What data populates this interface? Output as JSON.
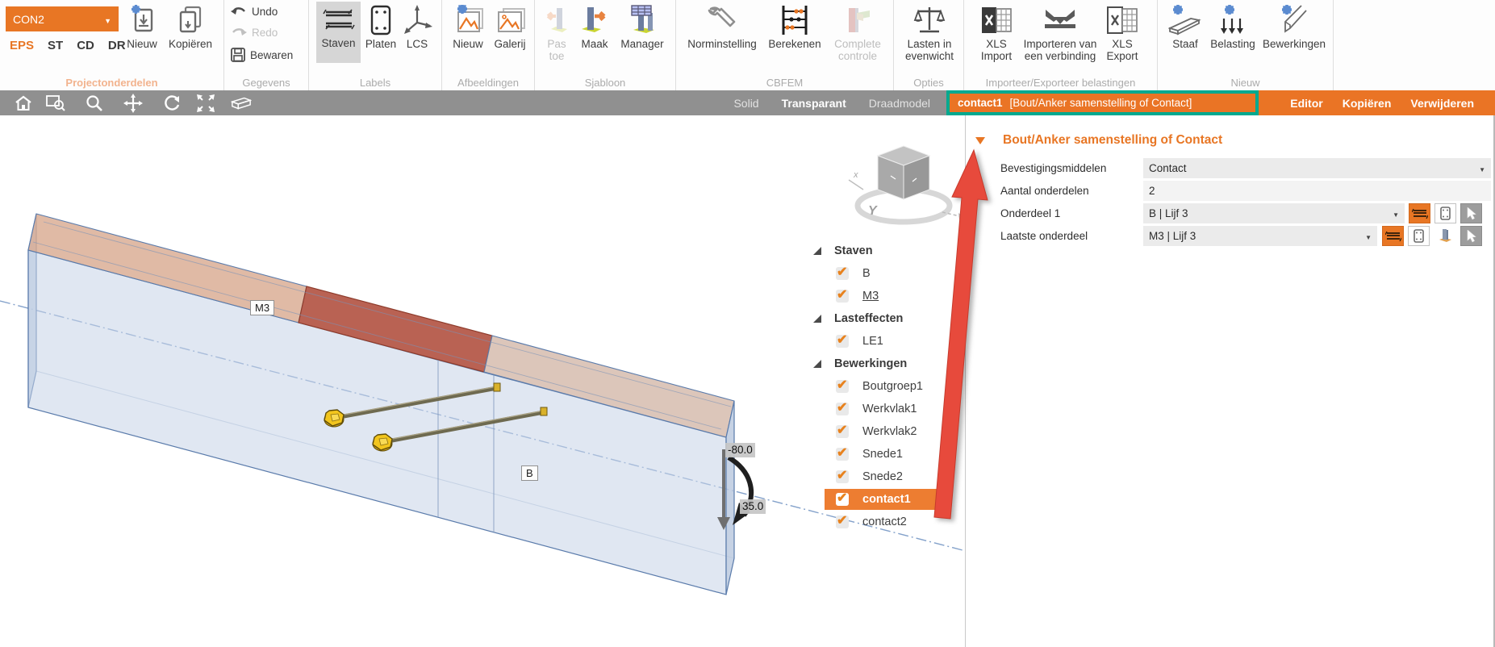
{
  "ribbon": {
    "project": {
      "selector": "CON2",
      "tabs": [
        "EPS",
        "ST",
        "CD",
        "DR"
      ],
      "active_tab": "EPS",
      "nieuw": "Nieuw",
      "kopieren": "Kopiëren",
      "group_label": "Projectonderdelen"
    },
    "gegevens": {
      "undo": "Undo",
      "redo": "Redo",
      "bewaren": "Bewaren",
      "group_label": "Gegevens"
    },
    "labels": {
      "staven": "Staven",
      "platen": "Platen",
      "lcs": "LCS",
      "group_label": "Labels",
      "active": "Staven"
    },
    "afbeeldingen": {
      "nieuw": "Nieuw",
      "galerij": "Galerij",
      "group_label": "Afbeeldingen"
    },
    "sjabloon": {
      "pas_toe": "Pas toe",
      "maak": "Maak",
      "manager": "Manager",
      "group_label": "Sjabloon"
    },
    "cbfem": {
      "norminstelling": "Norminstelling",
      "berekenen": "Berekenen",
      "complete_controle": "Complete controle",
      "group_label": "CBFEM"
    },
    "opties": {
      "lasten": "Lasten in evenwicht",
      "group_label": "Opties"
    },
    "import_export": {
      "xls_import": "XLS Import",
      "import_verbinding": "Importeren van een verbinding",
      "xls_export": "XLS Export",
      "group_label": "Importeer/Exporteer belastingen"
    },
    "nieuw_groep": {
      "staaf": "Staaf",
      "belasting": "Belasting",
      "bewerkingen": "Bewerkingen",
      "group_label": "Nieuw"
    }
  },
  "viewbar": {
    "modes": [
      "Solid",
      "Transparant",
      "Draadmodel"
    ],
    "active_mode": "Transparant"
  },
  "selection_header": {
    "name": "contact1",
    "type": "[Bout/Anker samenstelling of Contact]",
    "actions": [
      "Editor",
      "Kopiëren",
      "Verwijderen"
    ]
  },
  "properties": {
    "section_title": "Bout/Anker samenstelling of Contact",
    "rows": [
      {
        "label": "Bevestigingsmiddelen",
        "value": "Contact",
        "type": "dropdown"
      },
      {
        "label": "Aantal onderdelen",
        "value": "2",
        "type": "text"
      },
      {
        "label": "Onderdeel 1",
        "value": "B | Lijf 3",
        "type": "dropdown"
      },
      {
        "label": "Laatste onderdeel",
        "value": "M3 | Lijf 3",
        "type": "dropdown"
      }
    ]
  },
  "tree": {
    "groups": [
      {
        "label": "Staven",
        "items": [
          {
            "label": "B",
            "checked": true
          },
          {
            "label": "M3",
            "checked": true,
            "underlined": true
          }
        ]
      },
      {
        "label": "Lasteffecten",
        "items": [
          {
            "label": "LE1",
            "checked": true
          }
        ]
      },
      {
        "label": "Bewerkingen",
        "items": [
          {
            "label": "Boutgroep1",
            "checked": true
          },
          {
            "label": "Werkvlak1",
            "checked": true
          },
          {
            "label": "Werkvlak2",
            "checked": true
          },
          {
            "label": "Snede1",
            "checked": true
          },
          {
            "label": "Snede2",
            "checked": true
          },
          {
            "label": "contact1",
            "checked": true,
            "selected": true
          },
          {
            "label": "contact2",
            "checked": true
          }
        ]
      }
    ]
  },
  "viewport": {
    "member_labels": {
      "top": "M3",
      "bottom": "B"
    },
    "dimensions": {
      "top": "-80.0",
      "bottom": "35.0"
    },
    "axis_y": "Y",
    "axis_x": "x"
  },
  "colors": {
    "accent_orange": "#e87624",
    "header_orange": "#ea7425",
    "teal_highlight": "#00a98f",
    "selection_orange": "#ed7d31",
    "annotation_red": "#e74a3c",
    "toolbar_gray": "#909090",
    "contact_patch_red": "#b15140",
    "beam_blue": "#c6d4e8",
    "bolt_yellow": "#f2c51d"
  }
}
